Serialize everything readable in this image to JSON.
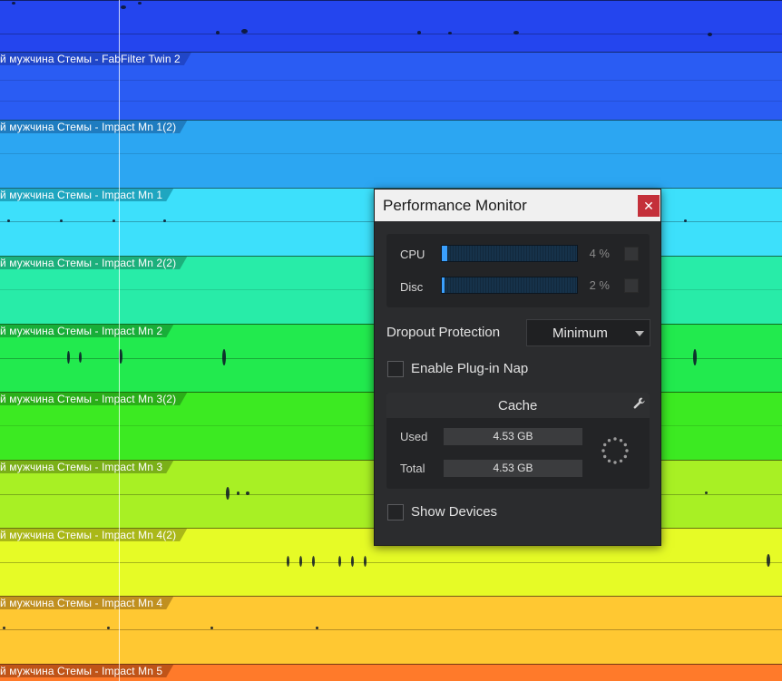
{
  "tracks": [
    {
      "label": "",
      "color": "#2445ee"
    },
    {
      "label": "й мужчина Стемы - FabFilter Twin 2",
      "color": "#2a5cf3",
      "label_bg": "#2046c8"
    },
    {
      "label": "й мужчина Стемы - Impact Mn 1(2)",
      "color": "#2ca6f2",
      "label_bg": "#1f7cc0"
    },
    {
      "label": "й мужчина Стемы - Impact Mn 1",
      "color": "#3de0fb",
      "label_bg": "#1fa6c0"
    },
    {
      "label": "й мужчина Стемы - Impact Mn 2(2)",
      "color": "#28eca8",
      "label_bg": "#1cb07c"
    },
    {
      "label": "й мужчина Стемы - Impact Mn 2",
      "color": "#22ea4e",
      "label_bg": "#18ae38"
    },
    {
      "label": "й мужчина Стемы - Impact Mn 3(2)",
      "color": "#3cea22",
      "label_bg": "#2aae18"
    },
    {
      "label": "й мужчина Стемы - Impact Mn 3",
      "color": "#a8f024",
      "label_bg": "#7ab018"
    },
    {
      "label": "й мужчина Стемы - Impact Mn 4(2)",
      "color": "#e6fb26",
      "label_bg": "#aab818"
    },
    {
      "label": "й мужчина Стемы - Impact Mn 4",
      "color": "#ffc832",
      "label_bg": "#c09020"
    },
    {
      "label": "й мужчина Стемы - Impact Mn 5",
      "color": "#ff7a2a",
      "label_bg": "#c05418"
    }
  ],
  "performance_monitor": {
    "title": "Performance Monitor",
    "close_glyph": "✕",
    "meters": [
      {
        "label": "CPU",
        "value": "4 %",
        "fill_percent": 4
      },
      {
        "label": "Disc",
        "value": "2 %",
        "fill_percent": 2
      }
    ],
    "dropout_protection": {
      "label": "Dropout Protection",
      "value": "Minimum"
    },
    "enable_plugin_nap": {
      "label": "Enable Plug-in Nap",
      "checked": false
    },
    "cache": {
      "title": "Cache",
      "used_label": "Used",
      "used_value": "4.53 GB",
      "total_label": "Total",
      "total_value": "4.53 GB"
    },
    "show_devices": {
      "label": "Show Devices",
      "checked": false
    }
  },
  "colors": {
    "window_bg": "#2b2c2e",
    "titlebar_bg": "#f0f0f0",
    "close_red": "#c4303a",
    "meter_fill": "#3aa0ff"
  }
}
